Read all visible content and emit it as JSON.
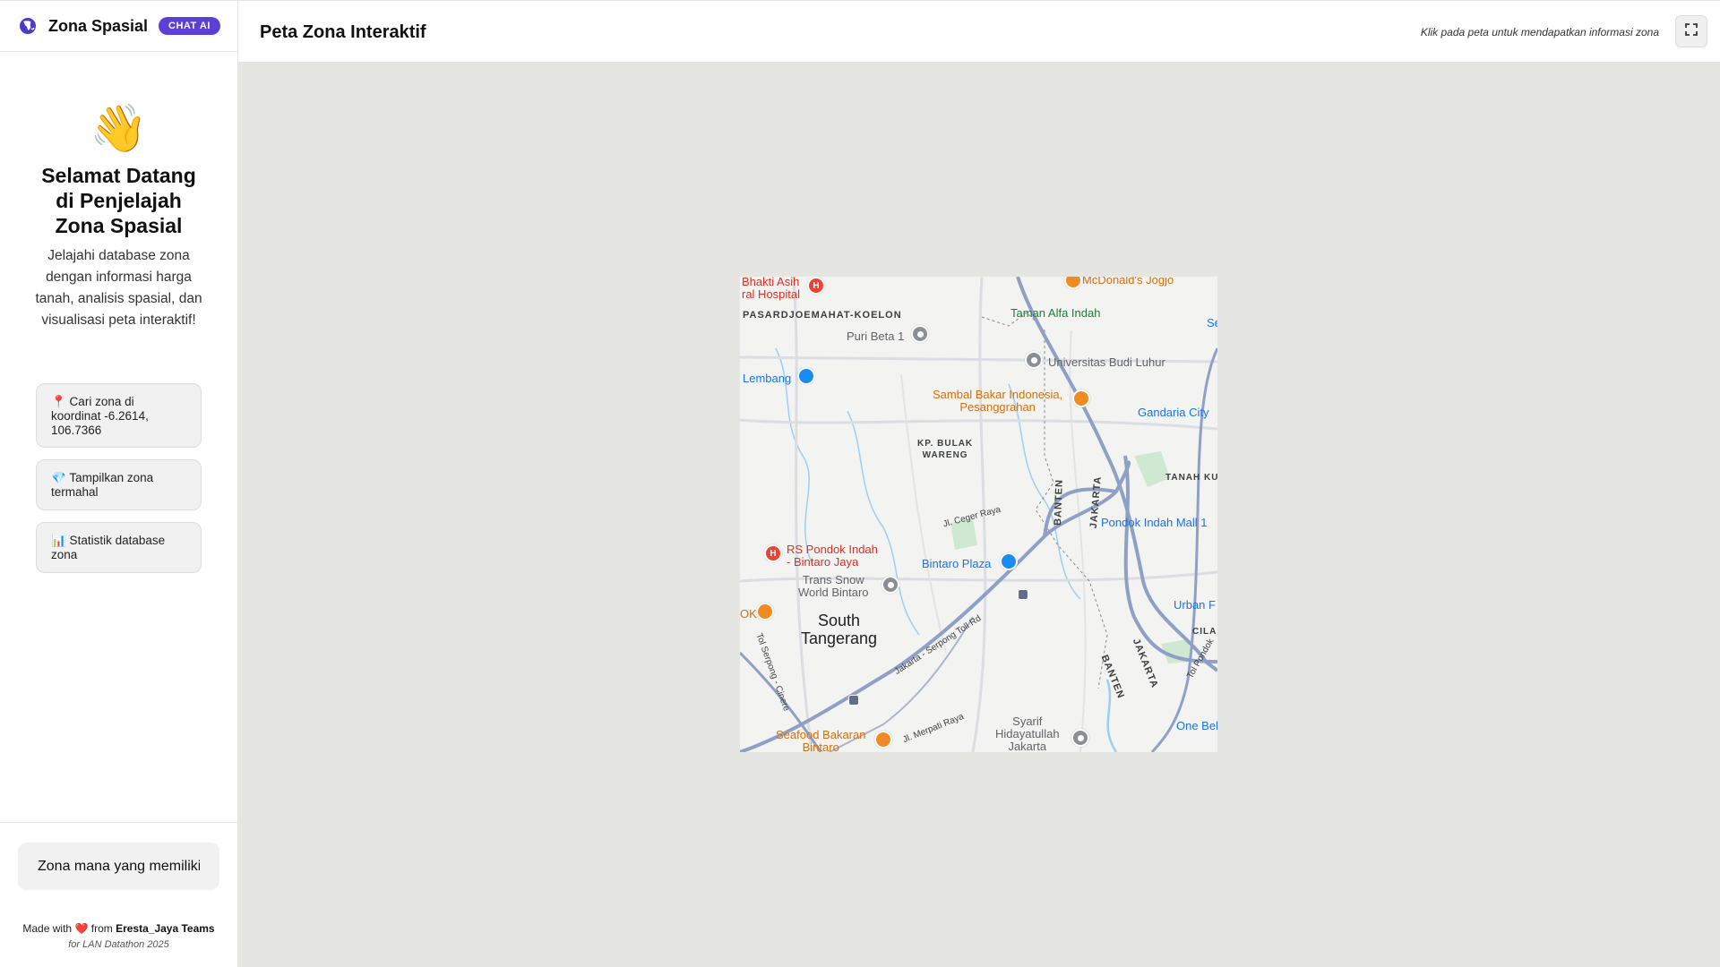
{
  "sidebar": {
    "brand": "Zona Spasial",
    "badge": "CHAT AI",
    "welcome_emoji": "👋",
    "welcome_title": "Selamat Datang di Penjelajah Zona Spasial",
    "welcome_desc": "Jelajahi database zona dengan informasi harga tanah, analisis spasial, dan visualisasi peta interaktif!",
    "suggestions": [
      "📍 Cari zona di koordinat -6.2614, 106.7366",
      "💎 Tampilkan zona termahal",
      "📊 Statistik database zona"
    ],
    "chat_input_value": "Zona mana yang memiliki ha",
    "footer_made": "Made with",
    "footer_heart": "❤️",
    "footer_from": "from",
    "footer_team": "Eresta_Jaya Teams",
    "footer_sub": "for LAN Datathon 2025"
  },
  "header": {
    "title": "Peta Zona Interaktif",
    "hint": "Klik pada peta untuk mendapatkan informasi zona"
  },
  "map": {
    "labels": {
      "hospital_top": "Bhakti Asih\nral Hospital",
      "mcd": "McDonald's Jogjo",
      "area_pasar": "PASARDJOEMAHAT-KOELON",
      "taman": "Taman Alfa Indah",
      "se": "Se",
      "puri": "Puri Beta 1",
      "ubl": "Universitas Budi Luhur",
      "lembang": "Lembang",
      "sambal": "Sambal Bakar Indonesia,\nPesanggrahan",
      "gandaria": "Gandaria City",
      "kp_bulak": "KP. BULAK\nWARENG",
      "tanah": "TANAH KU",
      "banten1": "BANTEN",
      "jakarta1": "JAKARTA",
      "ceger": "Jl. Ceger Raya",
      "pondok": "Pondok Indah Mall 1",
      "rs_pondok": "RS Pondok Indah\n- Bintaro Jaya",
      "bintaro_plaza": "Bintaro Plaza",
      "trans_snow": "Trans Snow\nWorld Bintaro",
      "ok": "OK",
      "south_tangerang": "South\nTangerang",
      "tol_road": "Jakarta - Serpong Toll Rd",
      "urban": "Urban F",
      "cila": "CILA",
      "jakarta2": "JAKARTA",
      "banten2": "BANTEN",
      "tol_serpong": "Tol Serpong - Cinere",
      "tol_pondok": "Tol Pondok",
      "seafood": "Seafood Bakaran\nBintaro",
      "merpati": "Jl. Merpati Raya",
      "syarif": "Syarif\nHidayatullah\nJakarta",
      "one_bel": "One Bel"
    }
  },
  "icons": {
    "logo": "globe-icon",
    "fullscreen": "fullscreen-icon",
    "hospital": "hospital-pin-icon",
    "shopping": "shopping-pin-icon",
    "restaurant": "restaurant-pin-icon",
    "place": "place-pin-icon",
    "school": "school-pin-icon",
    "train": "train-station-icon"
  },
  "colors": {
    "accent": "#5b3fd6",
    "map_background": "#e5e5e2"
  }
}
